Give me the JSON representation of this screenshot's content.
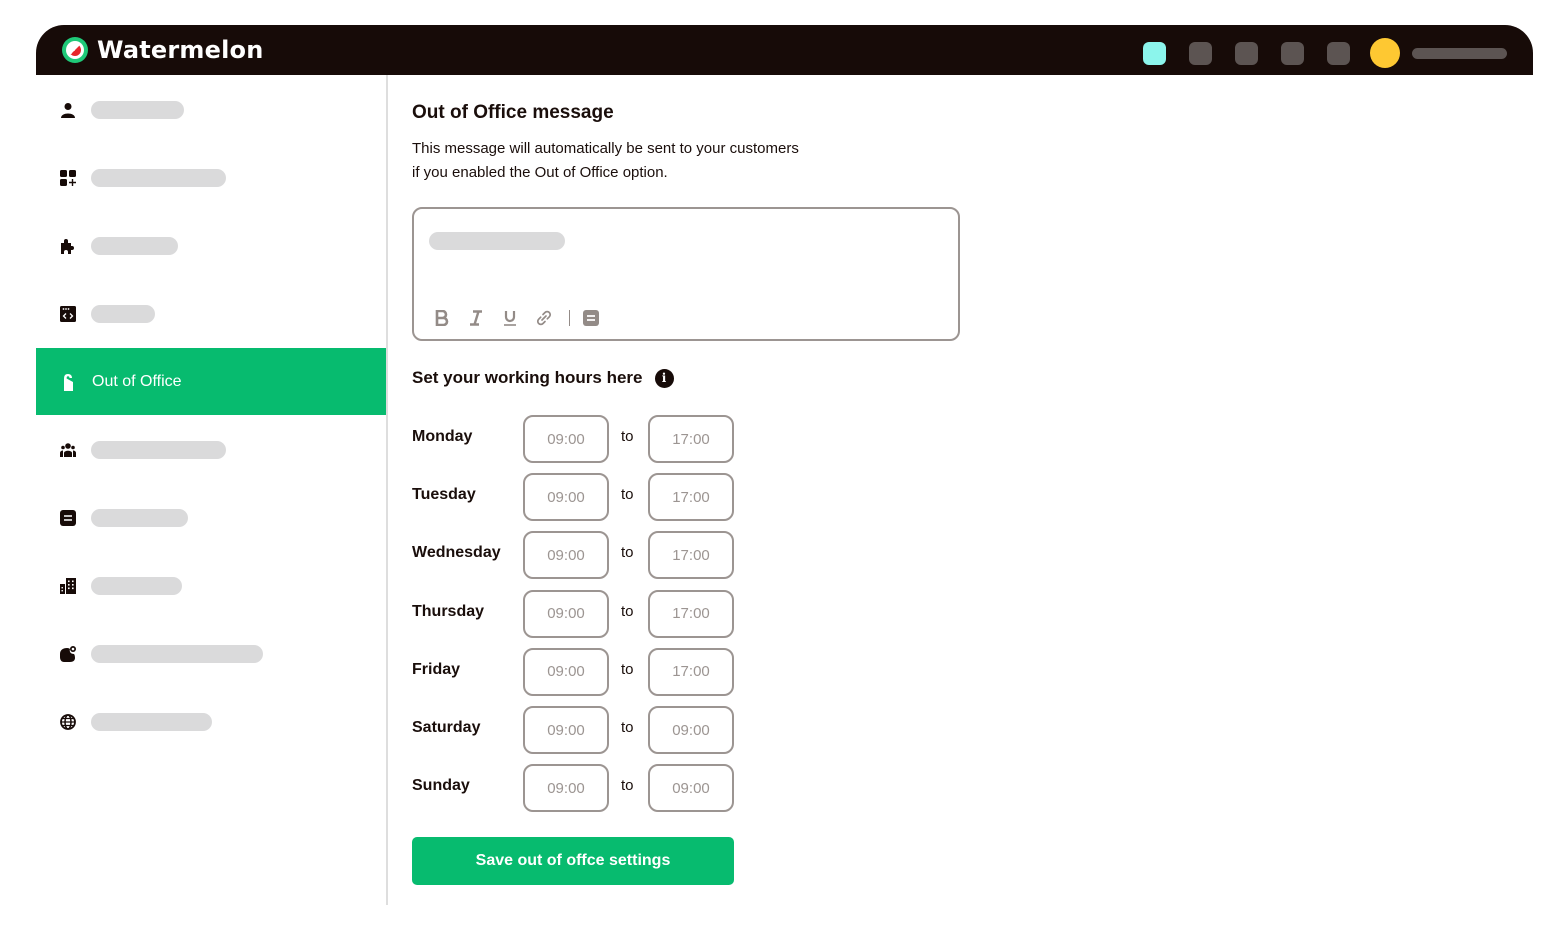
{
  "app": {
    "name": "Watermelon",
    "colors": {
      "topbar": "#170b08",
      "accent": "#07bb6f",
      "active_top_button": "#8cf5ec",
      "avatar": "#fec832"
    }
  },
  "topbar": {
    "buttons": [
      "active",
      "default",
      "default",
      "default",
      "default"
    ],
    "avatar_icon": "user-avatar",
    "username_placeholder": true
  },
  "sidebar": {
    "items": [
      {
        "icon": "person-icon",
        "label": null,
        "active": false
      },
      {
        "icon": "add-widget-icon",
        "label": null,
        "active": false
      },
      {
        "icon": "puzzle-icon",
        "label": null,
        "active": false
      },
      {
        "icon": "code-window-icon",
        "label": null,
        "active": false
      },
      {
        "icon": "door-hanger-icon",
        "label": "Out of Office",
        "active": true
      },
      {
        "icon": "team-icon",
        "label": null,
        "active": false
      },
      {
        "icon": "notes-icon",
        "label": null,
        "active": false
      },
      {
        "icon": "building-icon",
        "label": null,
        "active": false
      },
      {
        "icon": "notification-badge-icon",
        "label": null,
        "active": false
      },
      {
        "icon": "globe-icon",
        "label": null,
        "active": false
      }
    ]
  },
  "main": {
    "title": "Out of Office message",
    "description_line1": "This message will automatically be sent to your customers",
    "description_line2": "if you enabled the Out of Office option.",
    "editor": {
      "toolbar": {
        "bold": "B",
        "italic": "I",
        "underline": "U",
        "link": "link",
        "template": "template"
      }
    },
    "hours_title": "Set your working hours here",
    "info_icon": "i",
    "to_label": "to",
    "days": [
      {
        "day": "Monday",
        "from": "09:00",
        "to": "17:00"
      },
      {
        "day": "Tuesday",
        "from": "09:00",
        "to": "17:00"
      },
      {
        "day": "Wednesday",
        "from": "09:00",
        "to": "17:00"
      },
      {
        "day": "Thursday",
        "from": "09:00",
        "to": "17:00"
      },
      {
        "day": "Friday",
        "from": "09:00",
        "to": "17:00"
      },
      {
        "day": "Saturday",
        "from": "09:00",
        "to": "09:00"
      },
      {
        "day": "Sunday",
        "from": "09:00",
        "to": "09:00"
      }
    ],
    "save_button": "Save out of offce settings"
  }
}
